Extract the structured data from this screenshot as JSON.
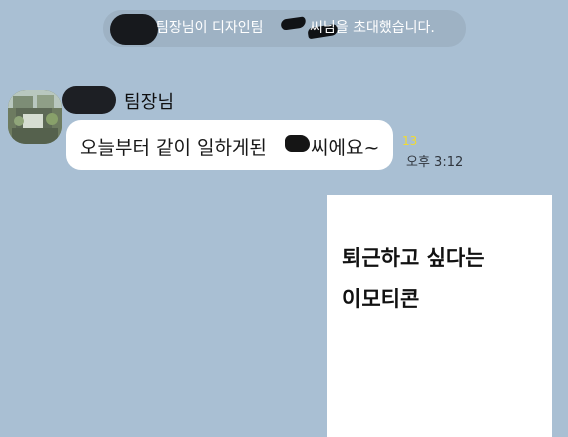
{
  "system_notice": {
    "text_prefix": "팀장님이 디자인팀",
    "text_suffix": "씨님을 초대했습니다."
  },
  "message": {
    "sender_name": "팀장님",
    "text_before_redaction": "오늘부터 같이 일하게된",
    "text_after_redaction": "씨에요~",
    "read_count": "13",
    "time": "오후 3:12"
  },
  "sticker_caption": {
    "line1": "퇴근하고 싶다는",
    "line2": "이모티콘"
  }
}
